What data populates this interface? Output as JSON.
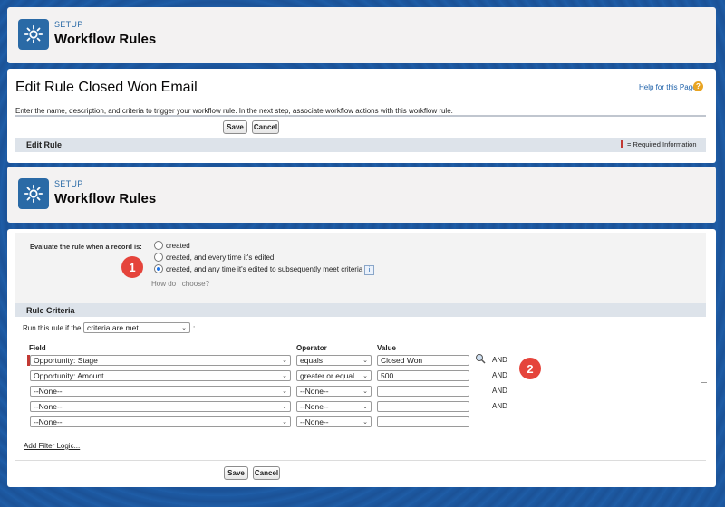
{
  "header_top": {
    "setup_label": "SETUP",
    "title": "Workflow Rules",
    "icon": "gear-icon"
  },
  "header_bottom": {
    "setup_label": "SETUP",
    "title": "Workflow Rules",
    "icon": "gear-icon"
  },
  "edit": {
    "title": "Edit Rule Closed Won Email",
    "help_link": "Help for this Page",
    "description": "Enter the name, description, and criteria to trigger your workflow rule. In the next step, associate workflow actions with this workflow rule.",
    "save_label": "Save",
    "cancel_label": "Cancel",
    "section_title": "Edit Rule",
    "required_info": "= Required Information"
  },
  "evaluate": {
    "label": "Evaluate the rule when a record is:",
    "options": [
      "created",
      "created, and every time it's edited",
      "created, and any time it's edited to subsequently meet criteria"
    ],
    "selected_index": 2,
    "how_link": "How do I choose?"
  },
  "criteria": {
    "section_title": "Rule Criteria",
    "run_label": "Run this rule if the",
    "run_value": "criteria are met",
    "run_suffix": ":",
    "col_field": "Field",
    "col_operator": "Operator",
    "col_value": "Value",
    "rows": [
      {
        "field": "Opportunity: Stage",
        "operator": "equals",
        "value": "Closed Won",
        "conj": "AND"
      },
      {
        "field": "Opportunity: Amount",
        "operator": "greater or equal",
        "value": "500",
        "conj": "AND"
      },
      {
        "field": "--None--",
        "operator": "--None--",
        "value": "",
        "conj": "AND"
      },
      {
        "field": "--None--",
        "operator": "--None--",
        "value": "",
        "conj": "AND"
      },
      {
        "field": "--None--",
        "operator": "--None--",
        "value": "",
        "conj": ""
      }
    ],
    "add_filter_logic": "Add Filter Logic...",
    "save_label": "Save",
    "cancel_label": "Cancel"
  },
  "callouts": {
    "one": "1",
    "two": "2"
  },
  "colors": {
    "accent": "#2a6aa6",
    "badge": "#e5443b",
    "required": "#c23934"
  }
}
